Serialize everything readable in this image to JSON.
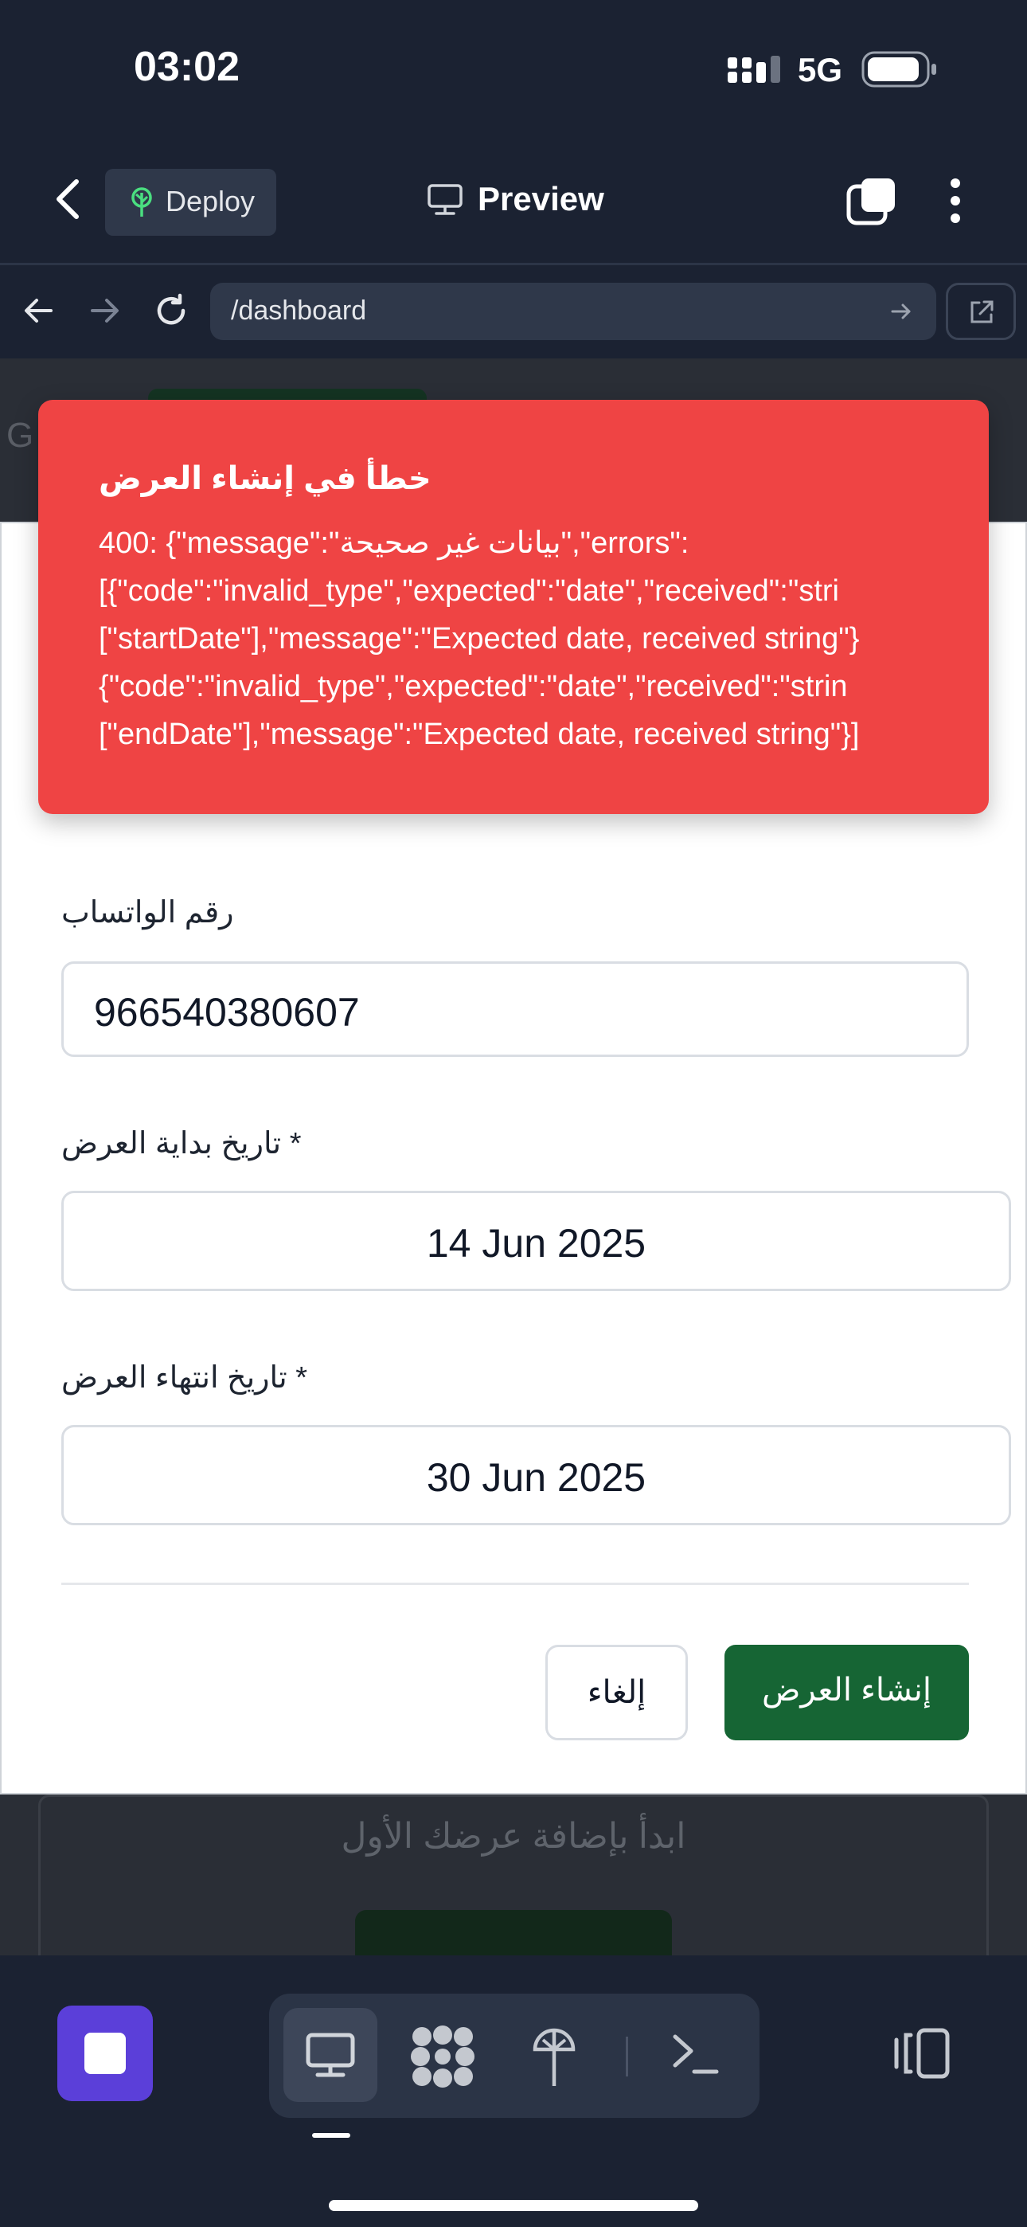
{
  "status_bar": {
    "time": "03:02",
    "network": "5G"
  },
  "header": {
    "deploy_label": "Deploy",
    "preview_label": "Preview"
  },
  "urlbar": {
    "path": "/dashboard"
  },
  "background_page": {
    "empty_text": "ابدأ بإضافة عرضك الأول",
    "left_edge_char": "G"
  },
  "toast": {
    "title": "خطأ في إنشاء العرض",
    "lines": [
      "400: {\"message\":\"بيانات غير صحيحة\",\"errors\":",
      "[{\"code\":\"invalid_type\",\"expected\":\"date\",\"received\":\"stri",
      "[\"startDate\"],\"message\":\"Expected date, received string\"}",
      "{\"code\":\"invalid_type\",\"expected\":\"date\",\"received\":\"strin",
      "[\"endDate\"],\"message\":\"Expected date, received string\"}]"
    ]
  },
  "form": {
    "whatsapp_label": "رقم الواتساب",
    "whatsapp_value": "966540380607",
    "start_label": "* تاريخ بداية العرض",
    "start_value": "14 Jun 2025",
    "end_label": "* تاريخ انتهاء العرض",
    "end_value": "30 Jun 2025",
    "cancel_label": "إلغاء",
    "submit_label": "إنشاء العرض"
  },
  "colors": {
    "toast_bg": "#ef4444",
    "submit_bg": "#166534",
    "stop_button_bg": "#5b3fd9",
    "app_bg": "#1b2232"
  },
  "icons": {
    "back": "chevron-left-icon",
    "deploy": "deploy-tree-icon",
    "preview": "monitor-icon",
    "tabs": "tabs-square-icon",
    "more": "vertical-dots-icon",
    "nav_back": "arrow-left-icon",
    "nav_forward": "arrow-right-icon",
    "reload": "reload-icon",
    "go": "arrow-right-small-icon",
    "open_external": "external-link-icon",
    "stop": "stop-square-icon",
    "tool_preview": "monitor-icon",
    "tool_grid": "dots-grid-icon",
    "tool_deploy": "deploy-tree-icon",
    "tool_shell": "terminal-icon",
    "layout": "split-panel-icon"
  }
}
